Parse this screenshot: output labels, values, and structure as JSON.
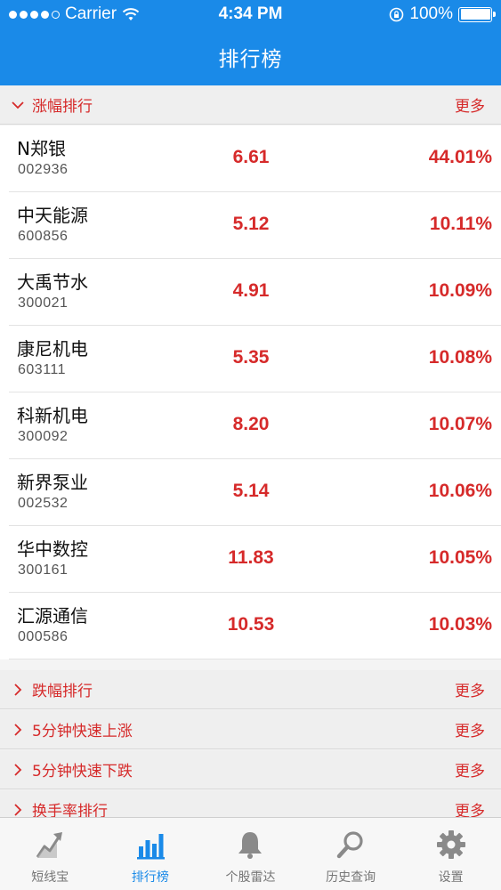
{
  "status_bar": {
    "carrier": "Carrier",
    "time": "4:34 PM",
    "battery": "100%"
  },
  "nav": {
    "title": "排行榜"
  },
  "sections": [
    {
      "title": "涨幅排行",
      "more": "更多",
      "expanded": true
    },
    {
      "title": "跌幅排行",
      "more": "更多",
      "expanded": false
    },
    {
      "title": "5分钟快速上涨",
      "more": "更多",
      "expanded": false
    },
    {
      "title": "5分钟快速下跌",
      "more": "更多",
      "expanded": false
    },
    {
      "title": "换手率排行",
      "more": "更多",
      "expanded": false
    }
  ],
  "stocks": [
    {
      "name": "N郑银",
      "code": "002936",
      "price": "6.61",
      "change": "44.01%"
    },
    {
      "name": "中天能源",
      "code": "600856",
      "price": "5.12",
      "change": "10.11%"
    },
    {
      "name": "大禹节水",
      "code": "300021",
      "price": "4.91",
      "change": "10.09%"
    },
    {
      "name": "康尼机电",
      "code": "603111",
      "price": "5.35",
      "change": "10.08%"
    },
    {
      "name": "科新机电",
      "code": "300092",
      "price": "8.20",
      "change": "10.07%"
    },
    {
      "name": "新界泵业",
      "code": "002532",
      "price": "5.14",
      "change": "10.06%"
    },
    {
      "name": "华中数控",
      "code": "300161",
      "price": "11.83",
      "change": "10.05%"
    },
    {
      "name": "汇源通信",
      "code": "000586",
      "price": "10.53",
      "change": "10.03%"
    }
  ],
  "tabs": [
    {
      "label": "短线宝",
      "icon": "trend-up-icon",
      "active": false
    },
    {
      "label": "排行榜",
      "icon": "bar-chart-icon",
      "active": true
    },
    {
      "label": "个股雷达",
      "icon": "bell-icon",
      "active": false
    },
    {
      "label": "历史查询",
      "icon": "search-icon",
      "active": false
    },
    {
      "label": "设置",
      "icon": "gear-icon",
      "active": false
    }
  ],
  "colors": {
    "brand": "#1a8ae8",
    "up": "#d62a2a",
    "inactive_icon": "#8a8a8a"
  }
}
